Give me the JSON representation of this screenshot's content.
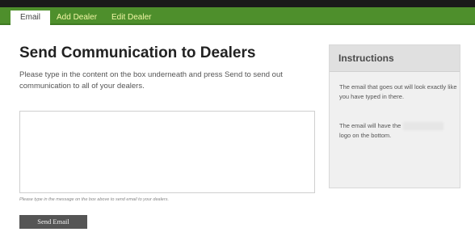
{
  "nav": {
    "tabs": [
      {
        "label": "Email",
        "active": true
      },
      {
        "label": "Add Dealer",
        "active": false
      },
      {
        "label": "Edit Dealer",
        "active": false
      }
    ]
  },
  "main": {
    "title": "Send Communication to Dealers",
    "description": "Please type in the content on the box underneath and press Send to send out communication to all of your dealers.",
    "message": {
      "value": "",
      "hint": "Please type in the message on the box above to send email to your dealers."
    },
    "send_button_label": "Send Email"
  },
  "instructions": {
    "title": "Instructions",
    "paragraph1": "The email that goes out will look exactly like you have typed in there.",
    "paragraph2_prefix": "The email will have the",
    "paragraph2_suffix": "logo on the bottom."
  },
  "colors": {
    "nav_green": "#4e8f2c",
    "tab_text": "#f3f7a6",
    "top_bar": "#1a1a1a",
    "button_bg": "#555555"
  }
}
